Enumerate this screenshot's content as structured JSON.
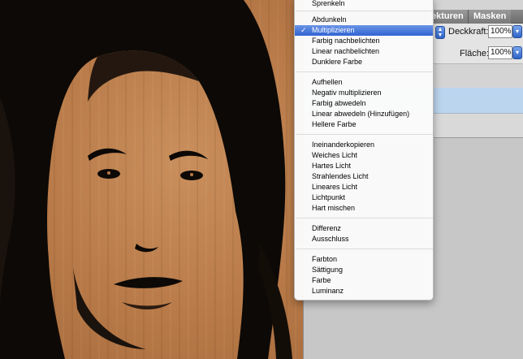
{
  "panel": {
    "tabs": [
      "ekturen",
      "Masken"
    ],
    "opacity_label": "Deckkraft:",
    "opacity_value": "100%",
    "fill_label": "Fläche:",
    "fill_value": "100%"
  },
  "blend_menu": {
    "selected": "Multiplizieren",
    "top_partial": "Sprenkeln",
    "groups": [
      [
        "Abdunkeln",
        "Multiplizieren",
        "Farbig nachbelichten",
        "Linear nachbelichten",
        "Dunklere Farbe"
      ],
      [
        "Aufhellen",
        "Negativ multiplizieren",
        "Farbig abwedeln",
        "Linear abwedeln (Hinzufügen)",
        "Hellere Farbe"
      ],
      [
        "Ineinanderkopieren",
        "Weiches Licht",
        "Hartes Licht",
        "Strahlendes Licht",
        "Lineares Licht",
        "Lichtpunkt",
        "Hart mischen"
      ],
      [
        "Differenz",
        "Ausschluss"
      ],
      [
        "Farbton",
        "Sättigung",
        "Farbe",
        "Luminanz"
      ]
    ]
  },
  "colors": {
    "menu_highlight": "#3b6fd8",
    "layer_selected": "#bcd5ef",
    "canvas_cardboard": "#b87a48"
  }
}
